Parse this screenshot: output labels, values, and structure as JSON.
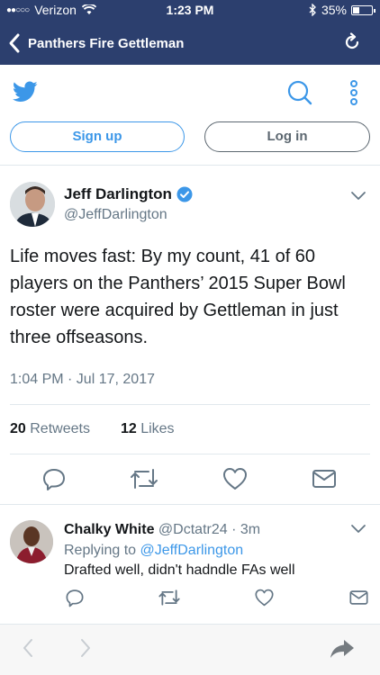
{
  "status_bar": {
    "carrier": "Verizon",
    "time": "1:23 PM",
    "battery": "35%",
    "battery_level": 0.35
  },
  "nav_bar": {
    "title": "Panthers Fire Gettleman"
  },
  "header": {
    "signup_label": "Sign up",
    "login_label": "Log in"
  },
  "tweet": {
    "author_name": "Jeff Darlington",
    "author_handle": "@JeffDarlington",
    "text": "Life moves fast: By my count, 41 of 60 players on the Panthers’ 2015 Super Bowl roster were acquired by Gettleman in just three offseasons.",
    "timestamp": "1:04 PM · Jul 17, 2017",
    "retweets_count": "20",
    "retweets_label": "Retweets",
    "likes_count": "12",
    "likes_label": "Likes"
  },
  "reply": {
    "name": "Chalky White",
    "handle_time": "@Dctatr24 · 3m",
    "replying_prefix": "Replying to",
    "replying_to": "@JeffDarlington",
    "text": "Drafted well, didn't hadndle FAs well"
  },
  "colors": {
    "nav_background": "#2c3f6e",
    "twitter_blue": "#3c97e8",
    "muted_text": "#657786"
  }
}
